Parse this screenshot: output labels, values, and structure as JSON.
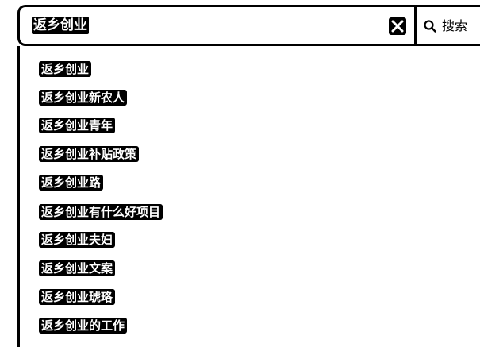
{
  "search": {
    "query": "返乡创业",
    "button_label": "搜索",
    "search_icon": "search-icon",
    "clear_icon": "close-icon"
  },
  "suggestions": [
    "返乡创业",
    "返乡创业新农人",
    "返乡创业青年",
    "返乡创业补贴政策",
    "返乡创业路",
    "返乡创业有什么好项目",
    "返乡创业夫妇",
    "返乡创业文案",
    "返乡创业琥珞",
    "返乡创业的工作"
  ]
}
